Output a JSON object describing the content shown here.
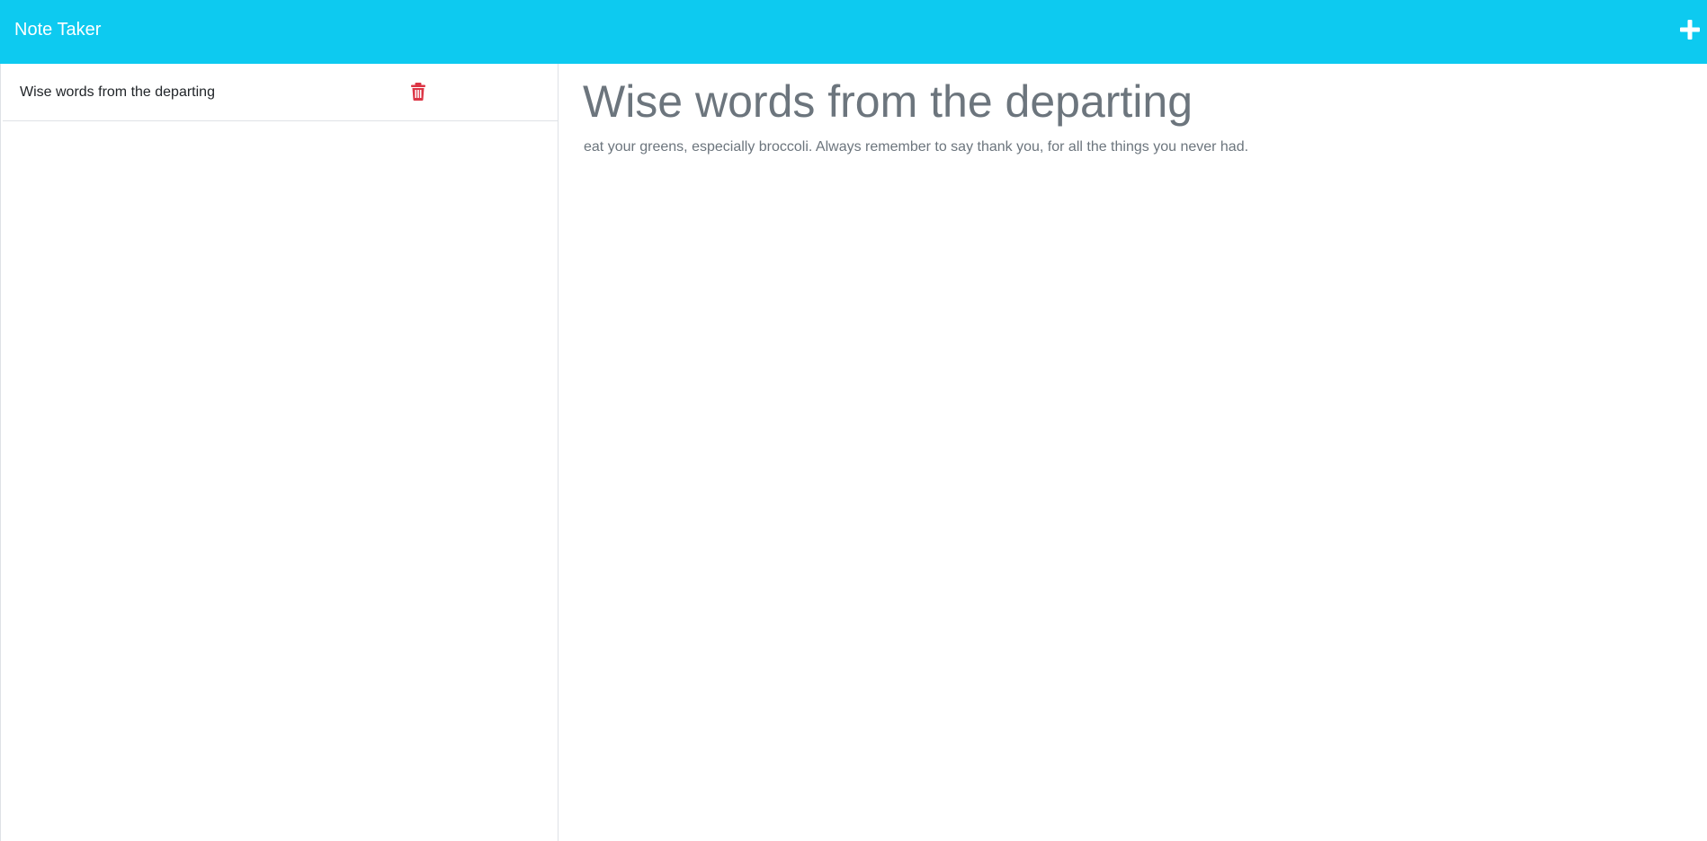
{
  "navbar": {
    "brand": "Note Taker",
    "new_note_icon": "plus-icon",
    "background": "#0dcaf0"
  },
  "notes": {
    "items": [
      {
        "title": "Wise words from the departing",
        "delete_icon": "trash-icon",
        "delete_color": "#dc3545"
      }
    ]
  },
  "editor": {
    "title": "Wise words from the departing",
    "text": "eat your greens, especially broccoli. Always remember to say thank you, for all the things you never had."
  }
}
